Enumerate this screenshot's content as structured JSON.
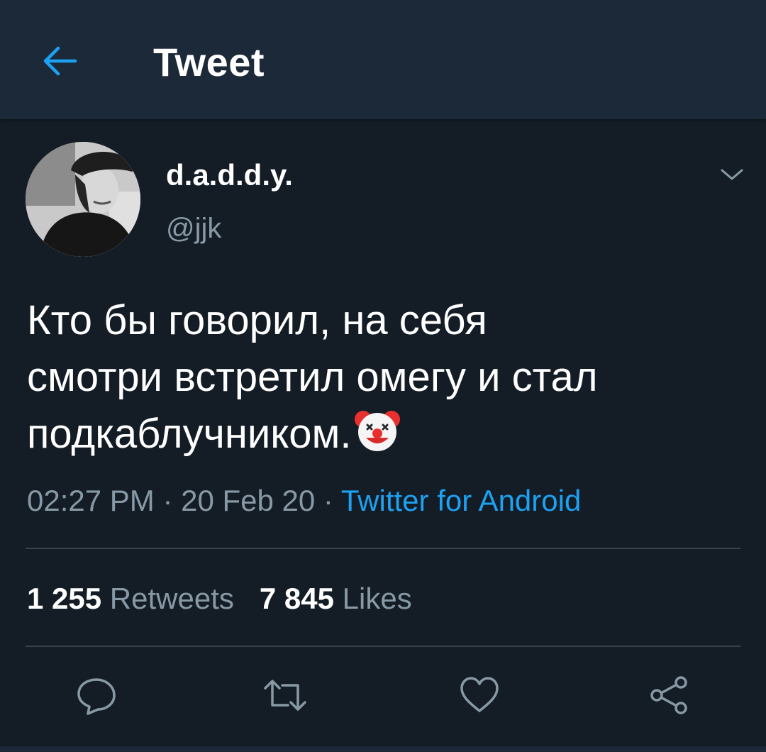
{
  "header": {
    "title": "Tweet",
    "back_icon": "arrow-left-icon",
    "accent_color": "#1da1f2"
  },
  "tweet": {
    "display_name": "d.a.d.d.y.",
    "handle": "@jjk",
    "text": "Кто бы говорил, на себя\nсмотри встретил омегу и стал\nподкаблучником.",
    "emoji": "clown-face",
    "time": "02:27 PM",
    "date": "20 Feb 20",
    "separator": " · ",
    "source": "Twitter for Android"
  },
  "stats": {
    "retweets_count": "1 255",
    "retweets_label": "Retweets",
    "likes_count": "7 845",
    "likes_label": "Likes"
  },
  "actions": [
    "reply-icon",
    "retweet-icon",
    "like-icon",
    "share-icon"
  ],
  "colors": {
    "background": "#141d26",
    "header_bg": "#1c2938",
    "secondary_text": "#8899a6",
    "link": "#1da1f2",
    "divider": "#38444d"
  }
}
